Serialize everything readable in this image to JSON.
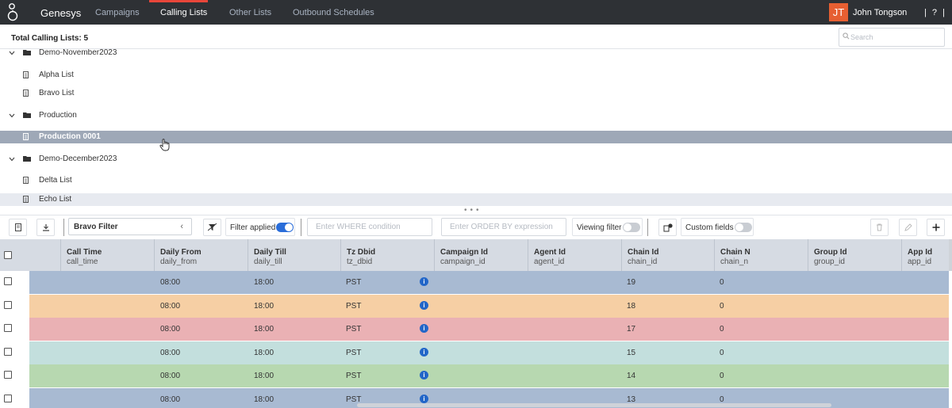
{
  "app": {
    "brand": "Genesys"
  },
  "nav": {
    "tabs": [
      {
        "label": "Campaigns",
        "active": false
      },
      {
        "label": "Calling Lists",
        "active": true
      },
      {
        "label": "Other Lists",
        "active": false
      },
      {
        "label": "Outbound Schedules",
        "active": false
      }
    ]
  },
  "user": {
    "initials": "JT",
    "name": "John Tongson",
    "help": "| ? |"
  },
  "list_panel": {
    "total": "Total Calling Lists: 5",
    "search_placeholder": "Search"
  },
  "tree": [
    {
      "type": "folder",
      "label": "Demo-November2023"
    },
    {
      "type": "list",
      "label": "Alpha List"
    },
    {
      "type": "list",
      "label": "Bravo List"
    },
    {
      "type": "folder",
      "label": "Production"
    },
    {
      "type": "list",
      "label": "Production 0001",
      "selected": true
    },
    {
      "type": "folder",
      "label": "Demo-December2023"
    },
    {
      "type": "list",
      "label": "Delta List"
    },
    {
      "type": "list",
      "label": "Echo List",
      "highlighted": true
    }
  ],
  "toolbar": {
    "filter_value": "Bravo Filter",
    "filter_applied_label": "Filter applied",
    "filter_applied_on": true,
    "where_placeholder": "Enter WHERE condition",
    "order_placeholder": "Enter ORDER BY expression",
    "viewing_filter_label": "Viewing filter",
    "viewing_filter_on": false,
    "custom_fields_label": "Custom fields",
    "custom_fields_on": false
  },
  "grid": {
    "columns": [
      {
        "title": "Call Time",
        "field": "call_time"
      },
      {
        "title": "Daily From",
        "field": "daily_from"
      },
      {
        "title": "Daily Till",
        "field": "daily_till"
      },
      {
        "title": "Tz Dbid",
        "field": "tz_dbid"
      },
      {
        "title": "Campaign Id",
        "field": "campaign_id"
      },
      {
        "title": "Agent Id",
        "field": "agent_id"
      },
      {
        "title": "Chain Id",
        "field": "chain_id"
      },
      {
        "title": "Chain N",
        "field": "chain_n"
      },
      {
        "title": "Group Id",
        "field": "group_id"
      },
      {
        "title": "App Id",
        "field": "app_id"
      }
    ],
    "rows": [
      {
        "color": "#a8bad2",
        "daily_from": "08:00",
        "daily_till": "18:00",
        "tz": "PST",
        "chain_id": "19",
        "chain_n": "0"
      },
      {
        "color": "#f6cfa4",
        "daily_from": "08:00",
        "daily_till": "18:00",
        "tz": "PST",
        "chain_id": "18",
        "chain_n": "0"
      },
      {
        "color": "#eab1b4",
        "daily_from": "08:00",
        "daily_till": "18:00",
        "tz": "PST",
        "chain_id": "17",
        "chain_n": "0"
      },
      {
        "color": "#c3dfdd",
        "daily_from": "08:00",
        "daily_till": "18:00",
        "tz": "PST",
        "chain_id": "15",
        "chain_n": "0"
      },
      {
        "color": "#b7d8b0",
        "daily_from": "08:00",
        "daily_till": "18:00",
        "tz": "PST",
        "chain_id": "14",
        "chain_n": "0"
      },
      {
        "color": "#a8bad2",
        "daily_from": "08:00",
        "daily_till": "18:00",
        "tz": "PST",
        "chain_id": "13",
        "chain_n": "0"
      }
    ]
  }
}
